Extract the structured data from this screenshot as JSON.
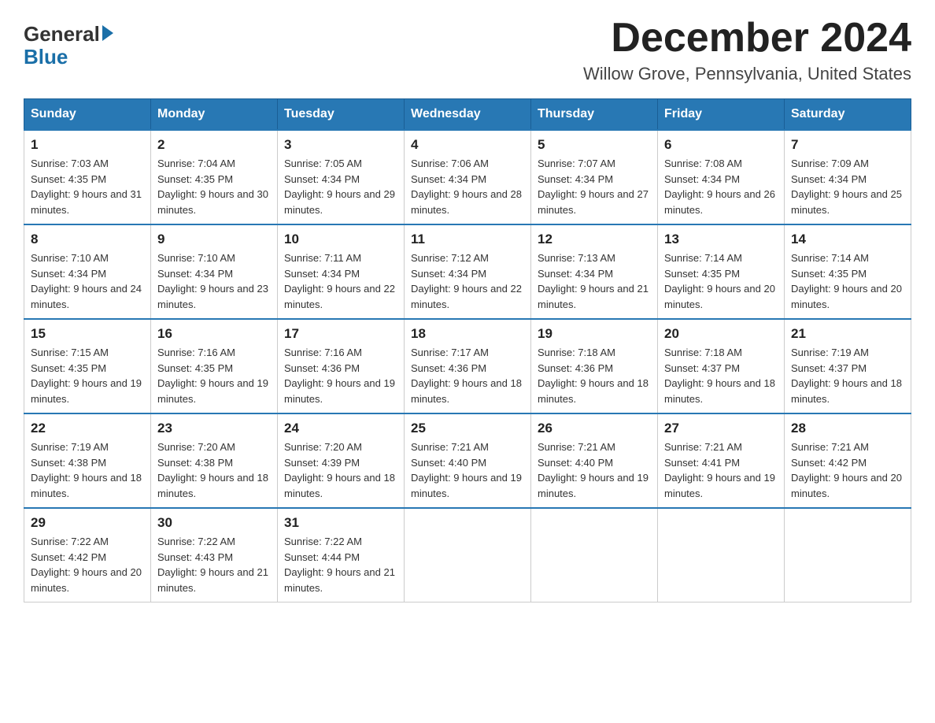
{
  "logo": {
    "general": "General",
    "blue": "Blue"
  },
  "title": "December 2024",
  "location": "Willow Grove, Pennsylvania, United States",
  "days_of_week": [
    "Sunday",
    "Monday",
    "Tuesday",
    "Wednesday",
    "Thursday",
    "Friday",
    "Saturday"
  ],
  "weeks": [
    [
      {
        "day": "1",
        "sunrise": "7:03 AM",
        "sunset": "4:35 PM",
        "daylight": "9 hours and 31 minutes."
      },
      {
        "day": "2",
        "sunrise": "7:04 AM",
        "sunset": "4:35 PM",
        "daylight": "9 hours and 30 minutes."
      },
      {
        "day": "3",
        "sunrise": "7:05 AM",
        "sunset": "4:34 PM",
        "daylight": "9 hours and 29 minutes."
      },
      {
        "day": "4",
        "sunrise": "7:06 AM",
        "sunset": "4:34 PM",
        "daylight": "9 hours and 28 minutes."
      },
      {
        "day": "5",
        "sunrise": "7:07 AM",
        "sunset": "4:34 PM",
        "daylight": "9 hours and 27 minutes."
      },
      {
        "day": "6",
        "sunrise": "7:08 AM",
        "sunset": "4:34 PM",
        "daylight": "9 hours and 26 minutes."
      },
      {
        "day": "7",
        "sunrise": "7:09 AM",
        "sunset": "4:34 PM",
        "daylight": "9 hours and 25 minutes."
      }
    ],
    [
      {
        "day": "8",
        "sunrise": "7:10 AM",
        "sunset": "4:34 PM",
        "daylight": "9 hours and 24 minutes."
      },
      {
        "day": "9",
        "sunrise": "7:10 AM",
        "sunset": "4:34 PM",
        "daylight": "9 hours and 23 minutes."
      },
      {
        "day": "10",
        "sunrise": "7:11 AM",
        "sunset": "4:34 PM",
        "daylight": "9 hours and 22 minutes."
      },
      {
        "day": "11",
        "sunrise": "7:12 AM",
        "sunset": "4:34 PM",
        "daylight": "9 hours and 22 minutes."
      },
      {
        "day": "12",
        "sunrise": "7:13 AM",
        "sunset": "4:34 PM",
        "daylight": "9 hours and 21 minutes."
      },
      {
        "day": "13",
        "sunrise": "7:14 AM",
        "sunset": "4:35 PM",
        "daylight": "9 hours and 20 minutes."
      },
      {
        "day": "14",
        "sunrise": "7:14 AM",
        "sunset": "4:35 PM",
        "daylight": "9 hours and 20 minutes."
      }
    ],
    [
      {
        "day": "15",
        "sunrise": "7:15 AM",
        "sunset": "4:35 PM",
        "daylight": "9 hours and 19 minutes."
      },
      {
        "day": "16",
        "sunrise": "7:16 AM",
        "sunset": "4:35 PM",
        "daylight": "9 hours and 19 minutes."
      },
      {
        "day": "17",
        "sunrise": "7:16 AM",
        "sunset": "4:36 PM",
        "daylight": "9 hours and 19 minutes."
      },
      {
        "day": "18",
        "sunrise": "7:17 AM",
        "sunset": "4:36 PM",
        "daylight": "9 hours and 18 minutes."
      },
      {
        "day": "19",
        "sunrise": "7:18 AM",
        "sunset": "4:36 PM",
        "daylight": "9 hours and 18 minutes."
      },
      {
        "day": "20",
        "sunrise": "7:18 AM",
        "sunset": "4:37 PM",
        "daylight": "9 hours and 18 minutes."
      },
      {
        "day": "21",
        "sunrise": "7:19 AM",
        "sunset": "4:37 PM",
        "daylight": "9 hours and 18 minutes."
      }
    ],
    [
      {
        "day": "22",
        "sunrise": "7:19 AM",
        "sunset": "4:38 PM",
        "daylight": "9 hours and 18 minutes."
      },
      {
        "day": "23",
        "sunrise": "7:20 AM",
        "sunset": "4:38 PM",
        "daylight": "9 hours and 18 minutes."
      },
      {
        "day": "24",
        "sunrise": "7:20 AM",
        "sunset": "4:39 PM",
        "daylight": "9 hours and 18 minutes."
      },
      {
        "day": "25",
        "sunrise": "7:21 AM",
        "sunset": "4:40 PM",
        "daylight": "9 hours and 19 minutes."
      },
      {
        "day": "26",
        "sunrise": "7:21 AM",
        "sunset": "4:40 PM",
        "daylight": "9 hours and 19 minutes."
      },
      {
        "day": "27",
        "sunrise": "7:21 AM",
        "sunset": "4:41 PM",
        "daylight": "9 hours and 19 minutes."
      },
      {
        "day": "28",
        "sunrise": "7:21 AM",
        "sunset": "4:42 PM",
        "daylight": "9 hours and 20 minutes."
      }
    ],
    [
      {
        "day": "29",
        "sunrise": "7:22 AM",
        "sunset": "4:42 PM",
        "daylight": "9 hours and 20 minutes."
      },
      {
        "day": "30",
        "sunrise": "7:22 AM",
        "sunset": "4:43 PM",
        "daylight": "9 hours and 21 minutes."
      },
      {
        "day": "31",
        "sunrise": "7:22 AM",
        "sunset": "4:44 PM",
        "daylight": "9 hours and 21 minutes."
      },
      null,
      null,
      null,
      null
    ]
  ]
}
